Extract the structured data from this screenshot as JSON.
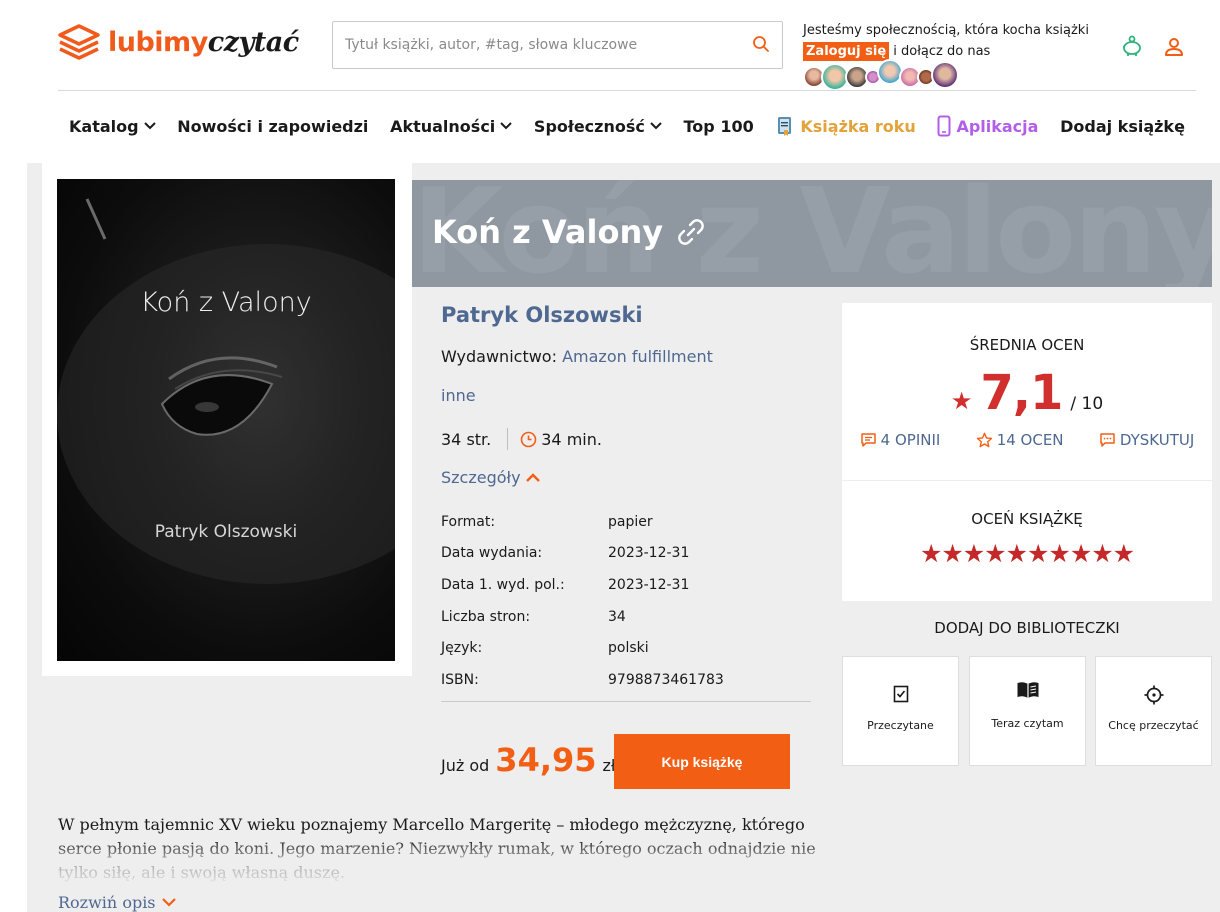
{
  "header": {
    "logo_main": "lubimy",
    "logo_accent": "czytać",
    "search_placeholder": "Tytuł książki, autor, #tag, słowa kluczowe",
    "community_text": "Jesteśmy społecznością, która kocha książki",
    "login_label": "Zaloguj się",
    "join_text": " i dołącz do nas"
  },
  "nav": {
    "items": [
      {
        "label": "Katalog"
      },
      {
        "label": "Nowości i zapowiedzi"
      },
      {
        "label": "Aktualności"
      },
      {
        "label": "Społeczność"
      },
      {
        "label": "Top 100"
      },
      {
        "label": "Książka roku"
      },
      {
        "label": "Aplikacja"
      },
      {
        "label": "Dodaj książkę"
      }
    ]
  },
  "book": {
    "title": "Koń z Valony",
    "cover_title": "Koń z Valony",
    "cover_author": "Patryk Olszowski",
    "author": "Patryk Olszowski",
    "publisher_label": "Wydawnictwo:",
    "publisher": "Amazon fulfillment",
    "category": "inne",
    "pages": "34 str.",
    "reading_time": "34 min.",
    "details_label": "Szczegóły",
    "details": [
      {
        "key": "Format:",
        "value": "papier"
      },
      {
        "key": "Data wydania:",
        "value": "2023-12-31"
      },
      {
        "key": "Data 1. wyd. pol.:",
        "value": "2023-12-31"
      },
      {
        "key": "Liczba stron:",
        "value": "34"
      },
      {
        "key": "Język:",
        "value": "polski"
      },
      {
        "key": "ISBN:",
        "value": "9798873461783"
      }
    ],
    "price_prefix": "Już od",
    "price": "34,95",
    "currency": "zł",
    "buy_label": "Kup książkę",
    "description": "W pełnym tajemnic XV wieku poznajemy Marcello Margeritę – młodego mężczyznę, którego serce płonie pasją do koni. Jego marzenie? Niezwykły rumak, w którego oczach odnajdzie nie tylko siłę, ale i swoją własną duszę.",
    "expand_label": "Rozwiń opis"
  },
  "rating": {
    "avg_label": "ŚREDNIA OCEN",
    "avg": "7,1",
    "max": "/ 10",
    "opinions": "4 OPINII",
    "ratings": "14 OCEN",
    "discuss": "DYSKUTUJ",
    "rate_label": "OCEŃ KSIĄŻKĘ",
    "stars": "★★★★★★★★★★"
  },
  "library": {
    "title": "DODAJ DO BIBLIOTECZKI",
    "items": [
      {
        "label": "Przeczytane",
        "icon": "checkbox-icon"
      },
      {
        "label": "Teraz czytam",
        "icon": "open-book-icon"
      },
      {
        "label": "Chcę przeczytać",
        "icon": "target-icon"
      }
    ]
  },
  "colors": {
    "brand_orange": "#f25e14",
    "link_blue": "#4e6891",
    "rating_red": "#d12e2e",
    "title_band": "#8f97a1"
  }
}
